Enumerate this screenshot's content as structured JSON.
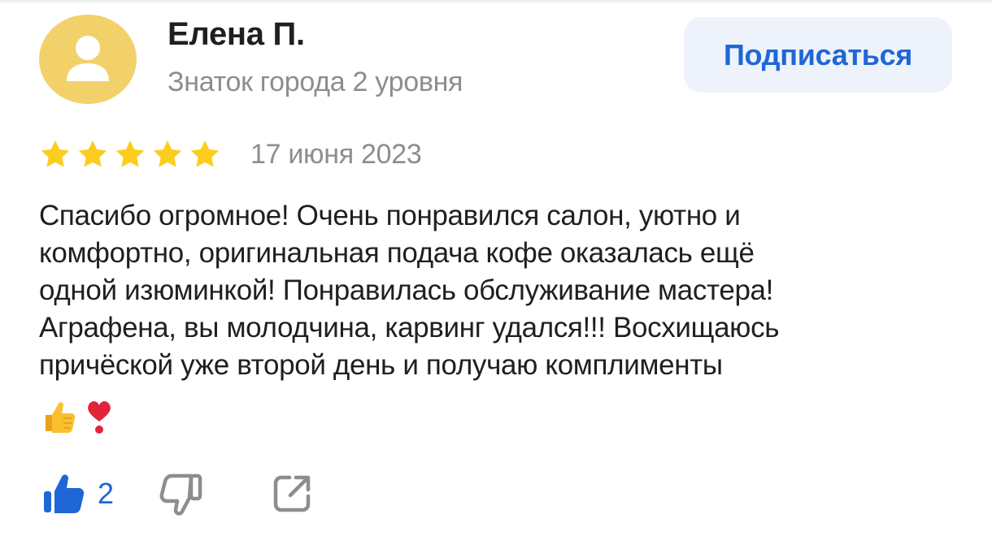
{
  "author": {
    "name": "Елена П.",
    "level": "Знаток города 2 уровня",
    "avatar_icon": "user-silhouette-icon",
    "avatar_color": "#f2d16b"
  },
  "subscribe": {
    "label": "Подписаться",
    "color": "#1f66d6",
    "background": "#eef2fb"
  },
  "review": {
    "rating": 5,
    "rating_max": 5,
    "star_color": "#fccc1e",
    "date": "17 июня 2023",
    "text_lines": [
      "Спасибо огромное! Очень понравился салон, уютно и",
      "комфортно, оригинальная подача кофе оказалась ещё",
      "одной изюминкой! Понравилась обслуживание мастера!",
      "Аграфена, вы молодчина, карвинг удался!!! Восхищаюсь",
      "причёской уже второй день и получаю комплименты"
    ],
    "emojis": [
      "thumbs-up-emoji",
      "heart-exclamation-emoji"
    ]
  },
  "actions": {
    "like_count": "2",
    "like_icon": "thumbs-up-icon",
    "dislike_icon": "thumbs-down-icon",
    "share_icon": "share-icon",
    "like_color": "#1f66d6",
    "icon_color": "#8d8d8d"
  }
}
